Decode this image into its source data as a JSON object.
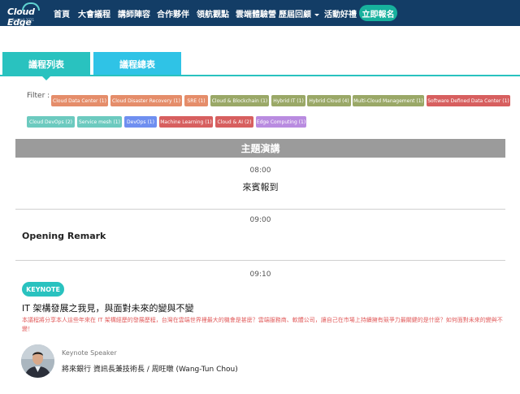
{
  "nav": {
    "logo_text": "Cloud Edge",
    "logo_sub": "Summit 2021",
    "items": [
      "首頁",
      "大會議程",
      "講師陣容",
      "合作夥伴",
      "領航觀點",
      "雲端體驗營",
      "歷屆回顧",
      "活動好禮"
    ],
    "register_label": "立即報名",
    "colors": {
      "bar": "#133d66",
      "register": "#17b19d"
    }
  },
  "tabs": [
    {
      "label": "議程列表",
      "active": true
    },
    {
      "label": "議程總表",
      "active": false
    }
  ],
  "filter": {
    "label": "Filter :",
    "chips": [
      {
        "label": "Cloud Data Center (1)",
        "color": "#e58d6a"
      },
      {
        "label": "Cloud Disaster Recovery (1)",
        "color": "#e58d6a"
      },
      {
        "label": "SRE (1)",
        "color": "#e58d6a"
      },
      {
        "label": "Cloud & Blockchain (1)",
        "color": "#9aa867"
      },
      {
        "label": "Hybrid IT (1)",
        "color": "#9aa867"
      },
      {
        "label": "Hybrid Cloud (4)",
        "color": "#9aa867"
      },
      {
        "label": "Multi-Cloud Management (1)",
        "color": "#9aa867"
      },
      {
        "label": "Software Defined Data Center (1)",
        "color": "#d75f5f"
      },
      {
        "label": "Cloud DevOps (2)",
        "color": "#6ccabf"
      },
      {
        "label": "Service mesh (1)",
        "color": "#6ccabf"
      },
      {
        "label": "DevOps (1)",
        "color": "#6f8ff0"
      },
      {
        "label": "Machine Learning (1)",
        "color": "#d75f5f"
      },
      {
        "label": "Cloud & AI (2)",
        "color": "#d75f5f"
      },
      {
        "label": "Edge Computing (1)",
        "color": "#b98be0"
      }
    ]
  },
  "section": {
    "title": "主題演講"
  },
  "sessions": [
    {
      "time": "08:00",
      "title": "來賓報到"
    },
    {
      "time": "09:00",
      "title": "Opening Remark"
    },
    {
      "time": "09:10",
      "badge": "KEYNOTE",
      "title": "IT 架構發展之我見，與面對未來的變與不變",
      "description": "本議程將分享本人這些年來在 IT 架構經歷的發展歷程，台灣在雲端世界裡最大的機會是甚麼？雲端服務商、軟體公司，讓自己在市場上持續擁有競爭力最關鍵的是什麼？如何面對未來的變與不變！",
      "speaker_role": "Keynote Speaker",
      "speaker_name": "將來銀行 資訊長兼技術長 / 周旺暾 (Wang-Tun Chou)"
    }
  ]
}
